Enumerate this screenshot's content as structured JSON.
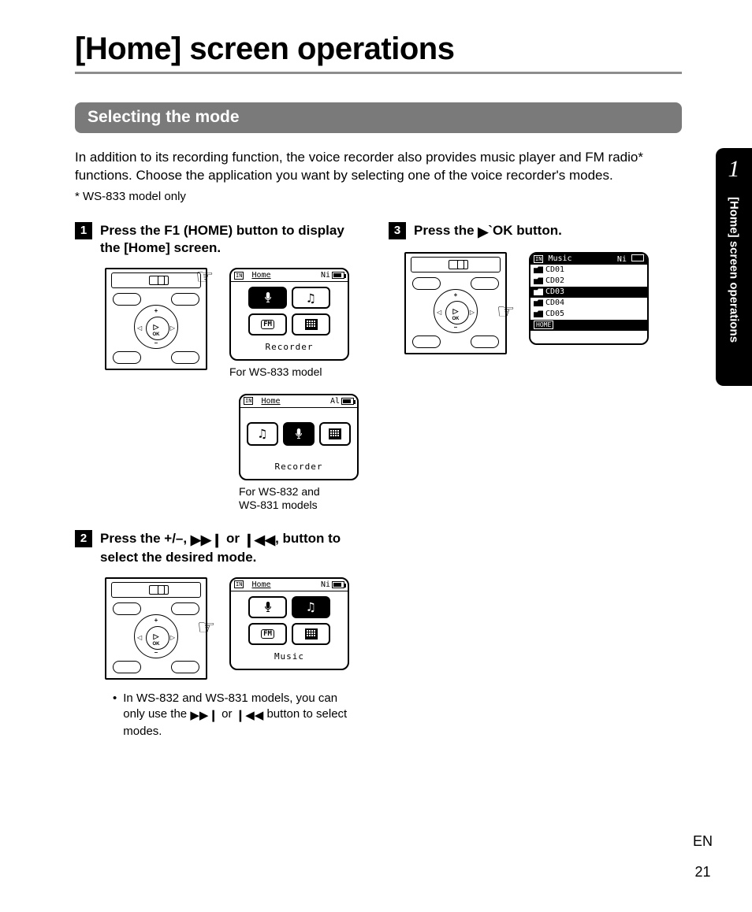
{
  "page_title": "[Home] screen operations",
  "section_title": "Selecting the mode",
  "intro": "In addition to its recording function, the voice recorder also provides music player and FM radio* functions. Choose the application you want by selecting one of the voice recorder's modes.",
  "footnote": "* WS-833 model only",
  "side_tab": {
    "chapter": "1",
    "label": "[Home] screen operations"
  },
  "footer": {
    "lang": "EN",
    "page": "21"
  },
  "steps": {
    "s1": {
      "num": "1",
      "pre": "Press the ",
      "btn": "F1 (HOME)",
      "post": " button to display the [",
      "home": "Home",
      "post2": "] screen."
    },
    "s2": {
      "num": "2",
      "pre": "Press the ",
      "keys": "+/–, ",
      "mid": " or ",
      "post": ", button to select the desired mode."
    },
    "s3": {
      "num": "3",
      "pre": "Press the ",
      "btn": "`OK",
      "post": " button."
    }
  },
  "captions": {
    "c1": "For WS-833 model",
    "c2_l1": "For WS-832 and",
    "c2_l2": "WS-831 models"
  },
  "bullet": {
    "pre": "In WS-832 and WS-831 models, you can only use the ",
    "mid": " or ",
    "post": " button to select modes."
  },
  "lcd": {
    "in": "IN",
    "home": "Home",
    "ni": "Ni",
    "al": "Al",
    "recorder": "Recorder",
    "music_label": "Music",
    "music_hdr": "Music",
    "home_ftr": "HOME",
    "folders": [
      "CD01",
      "CD02",
      "CD03",
      "CD04",
      "CD05"
    ],
    "selected_folder_index": 2
  },
  "icons": {
    "mic": "🎤",
    "note": "♫",
    "fm": "FM",
    "cal": "▦",
    "ffwd": "▶▶|",
    "rew": "|◀◀",
    "play": "▶"
  }
}
